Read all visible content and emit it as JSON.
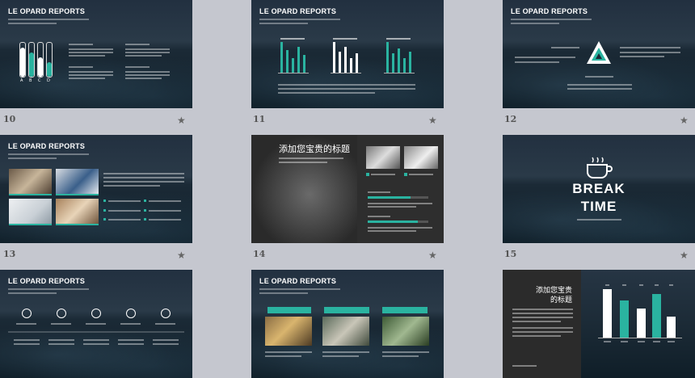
{
  "brand_title": "LE OPARD REPORTS",
  "slide_numbers": [
    "10",
    "11",
    "12",
    "13",
    "14",
    "15",
    "",
    "",
    ""
  ],
  "slide10": {
    "gauge_letters": [
      "A",
      "B",
      "C",
      "D"
    ]
  },
  "slide14": {
    "heading": "添加您宝贵的标题"
  },
  "slide15": {
    "line1": "BREAK",
    "line2": "TIME"
  },
  "slide18": {
    "heading_line1": "添加您宝贵",
    "heading_line2": "的标题"
  },
  "colors": {
    "accent": "#2ab3a0",
    "page_bg": "#c5c7cf",
    "number_text": "#555555"
  },
  "icons": [
    "star-icon",
    "coffee-cup-icon",
    "triangle-logo-icon"
  ]
}
